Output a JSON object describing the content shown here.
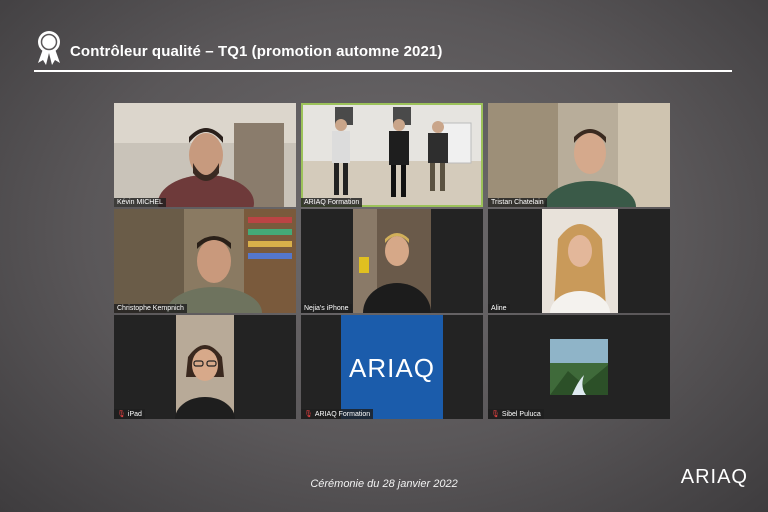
{
  "header": {
    "title": "Contrôleur qualité – TQ1  (promotion automne 2021)"
  },
  "participants": [
    {
      "name": "Kévin MICHEL",
      "muted": false
    },
    {
      "name": "ARIAQ Formation",
      "muted": false
    },
    {
      "name": "Tristan Chatelain",
      "muted": false
    },
    {
      "name": "Christophe Kempnich",
      "muted": false
    },
    {
      "name": "Nejia's iPhone",
      "muted": false
    },
    {
      "name": "Aline",
      "muted": false
    },
    {
      "name": "iPad",
      "muted": true
    },
    {
      "name": "ARIAQ Formation",
      "muted": true
    },
    {
      "name": "Sibel Puluca",
      "muted": true
    }
  ],
  "tile_logo": "ARIAQ",
  "footer": {
    "caption": "Cérémonie du 28 janvier 2022"
  },
  "brand": {
    "logo": "ARIAQ"
  },
  "colors": {
    "active_speaker_border": "#9cc25a",
    "logo_tile_blue": "#1b5cab",
    "mute_icon": "#e04040"
  }
}
